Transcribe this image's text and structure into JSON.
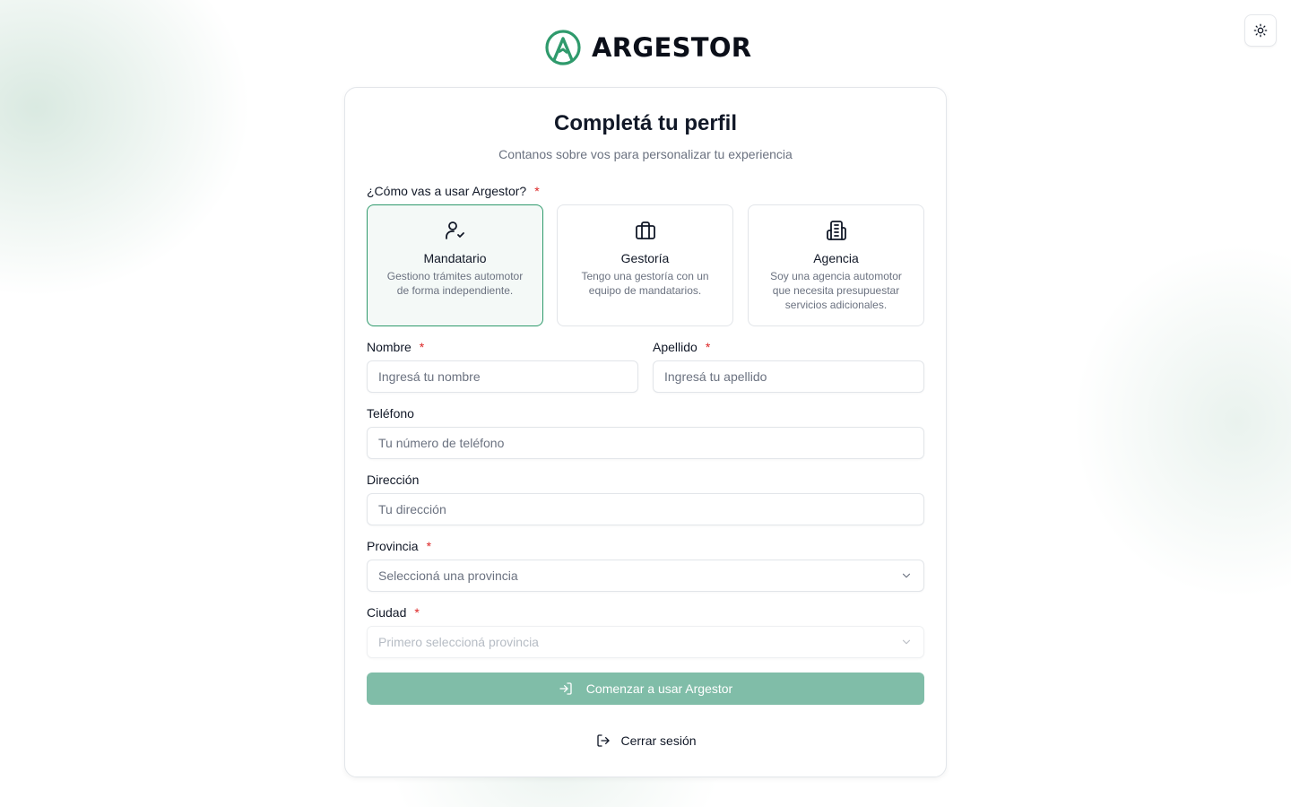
{
  "brand": {
    "name": "ARGESTOR"
  },
  "header": {
    "theme_toggle_icon": "sun-icon"
  },
  "form": {
    "title": "Completá tu perfil",
    "subtitle": "Contanos sobre vos para personalizar tu experiencia",
    "usage_label": "¿Cómo vas a usar Argestor?",
    "required_mark": "*",
    "options": [
      {
        "icon": "user-check-icon",
        "title": "Mandatario",
        "description": "Gestiono trámites automotor de forma independiente.",
        "selected": true
      },
      {
        "icon": "briefcase-icon",
        "title": "Gestoría",
        "description": "Tengo una gestoría con un equipo de mandatarios.",
        "selected": false
      },
      {
        "icon": "building-icon",
        "title": "Agencia",
        "description": "Soy una agencia automotor que necesita presupuestar servicios adicionales.",
        "selected": false
      }
    ],
    "nombre": {
      "label": "Nombre",
      "placeholder": "Ingresá tu nombre",
      "value": ""
    },
    "apellido": {
      "label": "Apellido",
      "placeholder": "Ingresá tu apellido",
      "value": ""
    },
    "telefono": {
      "label": "Teléfono",
      "placeholder": "Tu número de teléfono",
      "value": ""
    },
    "direccion": {
      "label": "Dirección",
      "placeholder": "Tu dirección",
      "value": ""
    },
    "provincia": {
      "label": "Provincia",
      "placeholder": "Seleccioná una provincia"
    },
    "ciudad": {
      "label": "Ciudad",
      "placeholder": "Primero seleccioná provincia"
    },
    "submit_label": "Comenzar a usar Argestor",
    "logout_label": "Cerrar sesión"
  },
  "colors": {
    "accent": "#2f9a6c",
    "button_disabled": "#80bda8",
    "required": "#dc2626"
  }
}
